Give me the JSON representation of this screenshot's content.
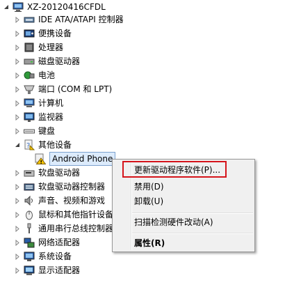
{
  "tree": {
    "root": {
      "label": "XZ-20120416CFDL",
      "icon": "computer-root-icon"
    },
    "items": [
      {
        "label": "IDE ATA/ATAPI 控制器",
        "icon": "ide-controller-icon",
        "expander": "collapsed"
      },
      {
        "label": "便携设备",
        "icon": "portable-device-icon",
        "expander": "collapsed"
      },
      {
        "label": "处理器",
        "icon": "processor-icon",
        "expander": "collapsed"
      },
      {
        "label": "磁盘驱动器",
        "icon": "disk-drive-icon",
        "expander": "collapsed"
      },
      {
        "label": "电池",
        "icon": "battery-icon",
        "expander": "collapsed"
      },
      {
        "label": "端口 (COM 和 LPT)",
        "icon": "port-icon",
        "expander": "collapsed"
      },
      {
        "label": "计算机",
        "icon": "computer-icon",
        "expander": "collapsed"
      },
      {
        "label": "监视器",
        "icon": "monitor-icon",
        "expander": "collapsed"
      },
      {
        "label": "键盘",
        "icon": "keyboard-icon",
        "expander": "collapsed"
      },
      {
        "label": "其他设备",
        "icon": "other-devices-icon",
        "expander": "expanded"
      },
      {
        "label": "Android Phone",
        "icon": "warning-device-icon",
        "expander": "none",
        "selected": true
      },
      {
        "label": "软盘驱动器",
        "icon": "floppy-drive-icon",
        "expander": "collapsed"
      },
      {
        "label": "软盘驱动器控制器",
        "icon": "floppy-controller-icon",
        "expander": "collapsed"
      },
      {
        "label": "声音、视频和游戏",
        "icon": "sound-icon",
        "expander": "collapsed"
      },
      {
        "label": "鼠标和其他指针设备",
        "icon": "mouse-icon",
        "expander": "collapsed"
      },
      {
        "label": "通用串行总线控制器",
        "icon": "usb-icon",
        "expander": "collapsed"
      },
      {
        "label": "网络适配器",
        "icon": "network-adapter-icon",
        "expander": "collapsed"
      },
      {
        "label": "系统设备",
        "icon": "system-device-icon",
        "expander": "collapsed"
      },
      {
        "label": "显示适配器",
        "icon": "display-adapter-icon",
        "expander": "collapsed"
      }
    ]
  },
  "context_menu": {
    "update_driver": "更新驱动程序软件(P)...",
    "disable": "禁用(D)",
    "uninstall": "卸载(U)",
    "scan_hardware": "扫描检测硬件改动(A)",
    "properties": "属性(R)"
  },
  "colors": {
    "highlight_box": "#d5141b",
    "selection_bg": "#dcebfc",
    "selection_border": "#7da2ce"
  }
}
